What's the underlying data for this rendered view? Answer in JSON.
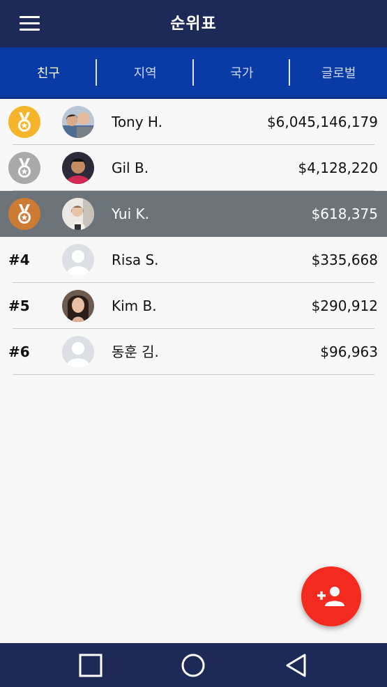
{
  "header": {
    "title": "순위표"
  },
  "tabs": [
    {
      "label": "친구",
      "active": true
    },
    {
      "label": "지역",
      "active": false
    },
    {
      "label": "국가",
      "active": false
    },
    {
      "label": "글로벌",
      "active": false
    }
  ],
  "leaderboard": [
    {
      "rank": "1",
      "medal": "gold-medal-icon",
      "name": "Tony H.",
      "score": "$6,045,146,179",
      "highlighted": false
    },
    {
      "rank": "2",
      "medal": "silver-medal-icon",
      "name": "Gil B.",
      "score": "$4,128,220",
      "highlighted": false
    },
    {
      "rank": "3",
      "medal": "bronze-medal-icon",
      "name": "Yui K.",
      "score": "$618,375",
      "highlighted": true
    },
    {
      "rank": "#4",
      "name": "Risa S.",
      "score": "$335,668",
      "highlighted": false
    },
    {
      "rank": "#5",
      "name": "Kim B.",
      "score": "$290,912",
      "highlighted": false
    },
    {
      "rank": "#6",
      "name": "동훈 김.",
      "score": "$96,963",
      "highlighted": false
    }
  ],
  "colors": {
    "app_bar": "#1d2a57",
    "tab_bar": "#0a3aa6",
    "highlight_row": "#6d7479",
    "gold": "#f6b42a",
    "silver": "#a9a9a9",
    "bronze": "#cd7a33",
    "fab": "#f52a1e"
  },
  "fab": {
    "icon": "add-person-icon"
  },
  "system_nav": {
    "icons": [
      "recent-apps-icon",
      "home-icon",
      "back-icon"
    ]
  }
}
